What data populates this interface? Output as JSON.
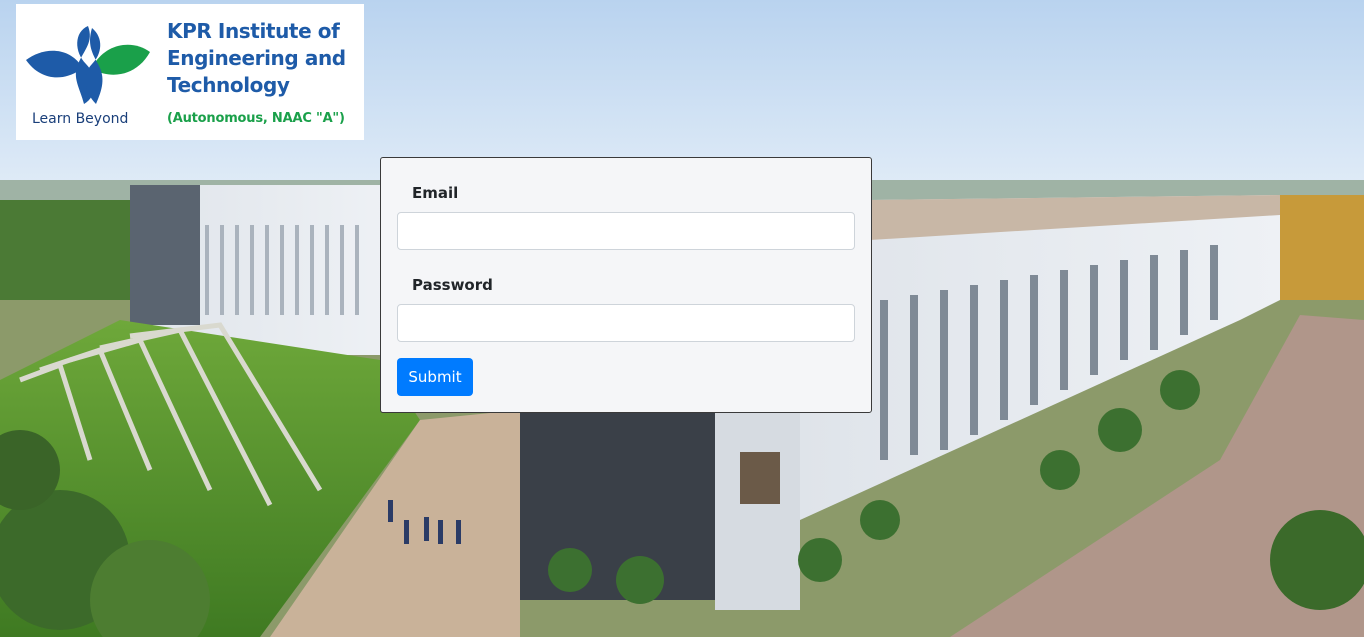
{
  "logo": {
    "name_lines": [
      "KPR Institute of",
      "Engineering and",
      "Technology"
    ],
    "tagline": "Learn Beyond",
    "accreditation": "(Autonomous, NAAC \"A\")",
    "icon": "kpr-logo-icon",
    "colors": {
      "blue": "#1e5ba8",
      "green": "#1aa04a",
      "navy": "#1a3f7a"
    }
  },
  "login": {
    "email_label": "Email",
    "email_value": "",
    "password_label": "Password",
    "password_value": "",
    "submit_label": "Submit",
    "colors": {
      "button": "#007bff",
      "card": "#f5f6f8"
    }
  },
  "background": {
    "icon": "campus-photo"
  }
}
